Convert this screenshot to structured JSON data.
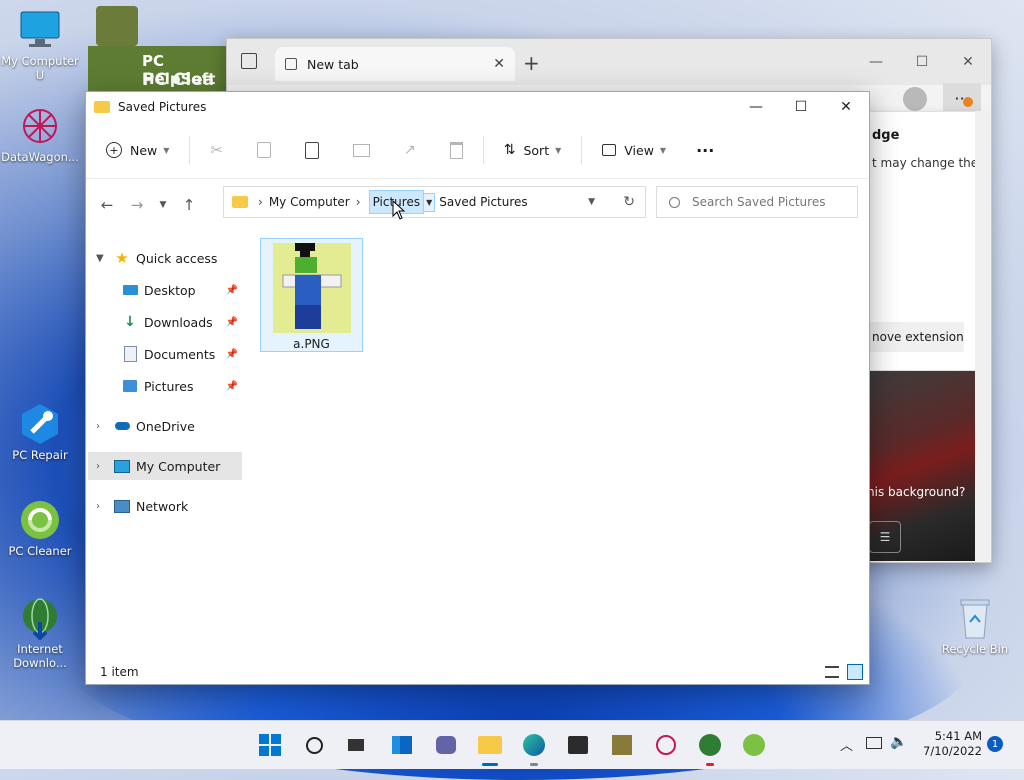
{
  "desktop": {
    "icons": [
      {
        "label": "My Computer U"
      },
      {
        "label": "DataWagon..."
      },
      {
        "label": "PC Repair"
      },
      {
        "label": "PC Cleaner"
      },
      {
        "label": "Internet Downlo..."
      },
      {
        "label": "Recycle Bin"
      }
    ],
    "pchelp_banner": "PC HelpSoft",
    "pchelp_banner2": "PC Clea"
  },
  "edge": {
    "tab_title": "New tab",
    "panel_heading": "dge",
    "panel_text": "t may change the",
    "panel_button": "nove extension",
    "bg_question": "nis background?"
  },
  "explorer": {
    "title": "Saved Pictures",
    "toolbar": {
      "new_label": "New",
      "sort_label": "Sort",
      "view_label": "View",
      "more_label": "···"
    },
    "address": {
      "crumbs": [
        "My Computer",
        "Pictures",
        "Saved Pictures"
      ]
    },
    "search": {
      "placeholder": "Search Saved Pictures"
    },
    "sidebar": {
      "quick_access": "Quick access",
      "items": [
        "Desktop",
        "Downloads",
        "Documents",
        "Pictures"
      ],
      "onedrive": "OneDrive",
      "my_computer": "My Computer",
      "network": "Network"
    },
    "files": [
      {
        "name": "a.PNG"
      }
    ],
    "status": {
      "count": "1 item"
    }
  },
  "taskbar": {
    "time": "5:41 AM",
    "date": "7/10/2022",
    "notification_count": "1"
  },
  "colors": {
    "accent": "#0067c0",
    "selection": "#cce8ff",
    "folder": "#f7c948"
  }
}
